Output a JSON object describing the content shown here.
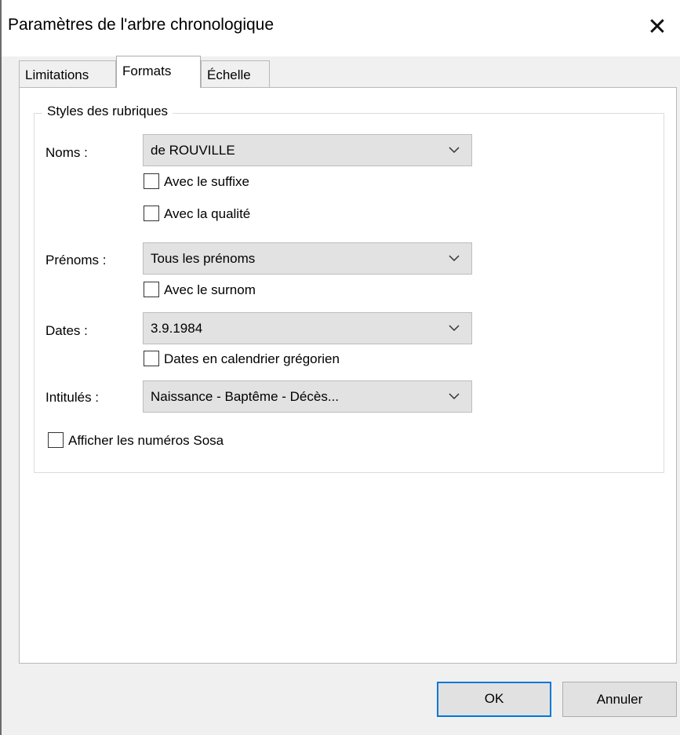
{
  "window": {
    "title": "Paramètres de l'arbre chronologique",
    "close_icon": "close-icon"
  },
  "tabs": [
    {
      "label": "Limitations",
      "selected": false
    },
    {
      "label": "Formats",
      "selected": true
    },
    {
      "label": "Échelle",
      "selected": false
    }
  ],
  "group": {
    "title": "Styles des rubriques",
    "noms": {
      "label": "Noms :",
      "value": "de ROUVILLE",
      "checkboxes": [
        {
          "label": "Avec le suffixe",
          "checked": false
        },
        {
          "label": "Avec la qualité",
          "checked": false
        }
      ]
    },
    "prenoms": {
      "label": "Prénoms :",
      "value": "Tous les prénoms",
      "checkboxes": [
        {
          "label": "Avec le surnom",
          "checked": false
        }
      ]
    },
    "dates": {
      "label": "Dates :",
      "value": "3.9.1984",
      "checkboxes": [
        {
          "label": "Dates en calendrier grégorien",
          "checked": false
        }
      ]
    },
    "intitules": {
      "label": "Intitulés :",
      "value": "Naissance - Baptême - Décès..."
    },
    "sosa": {
      "label": "Afficher les numéros Sosa",
      "checked": false
    }
  },
  "buttons": {
    "ok": "OK",
    "cancel": "Annuler"
  },
  "colors": {
    "accent": "#0078d7",
    "combo_bg": "#e2e2e2",
    "dialog_bg": "#f0f0f0"
  }
}
